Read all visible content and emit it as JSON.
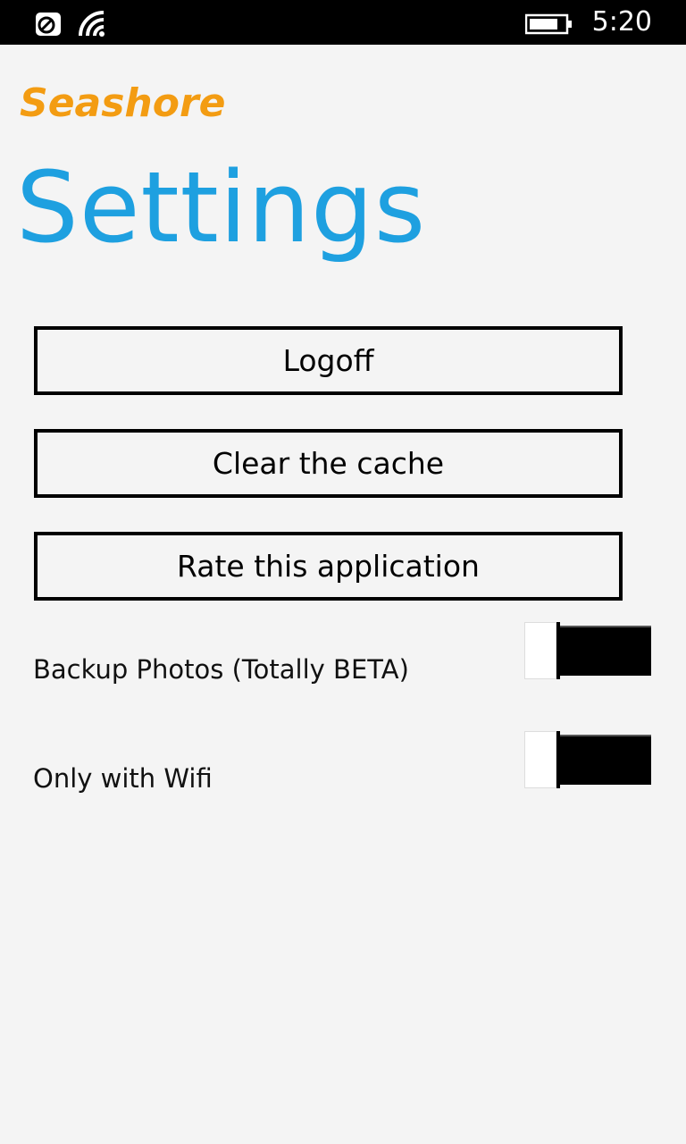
{
  "status_bar": {
    "time": "5:20",
    "icons": [
      "nfc-icon",
      "wifi-signal-icon",
      "battery-icon"
    ]
  },
  "app": {
    "name": "Seashore",
    "brand_color": "#f39c12"
  },
  "page": {
    "title": "Settings",
    "accent_color": "#1ea0e0"
  },
  "buttons": {
    "logoff": "Logoff",
    "clear_cache": "Clear the cache",
    "rate": "Rate this application"
  },
  "toggles": [
    {
      "label": "Backup Photos (Totally BETA)",
      "on": true
    },
    {
      "label": "Only with Wifi",
      "on": true
    }
  ]
}
